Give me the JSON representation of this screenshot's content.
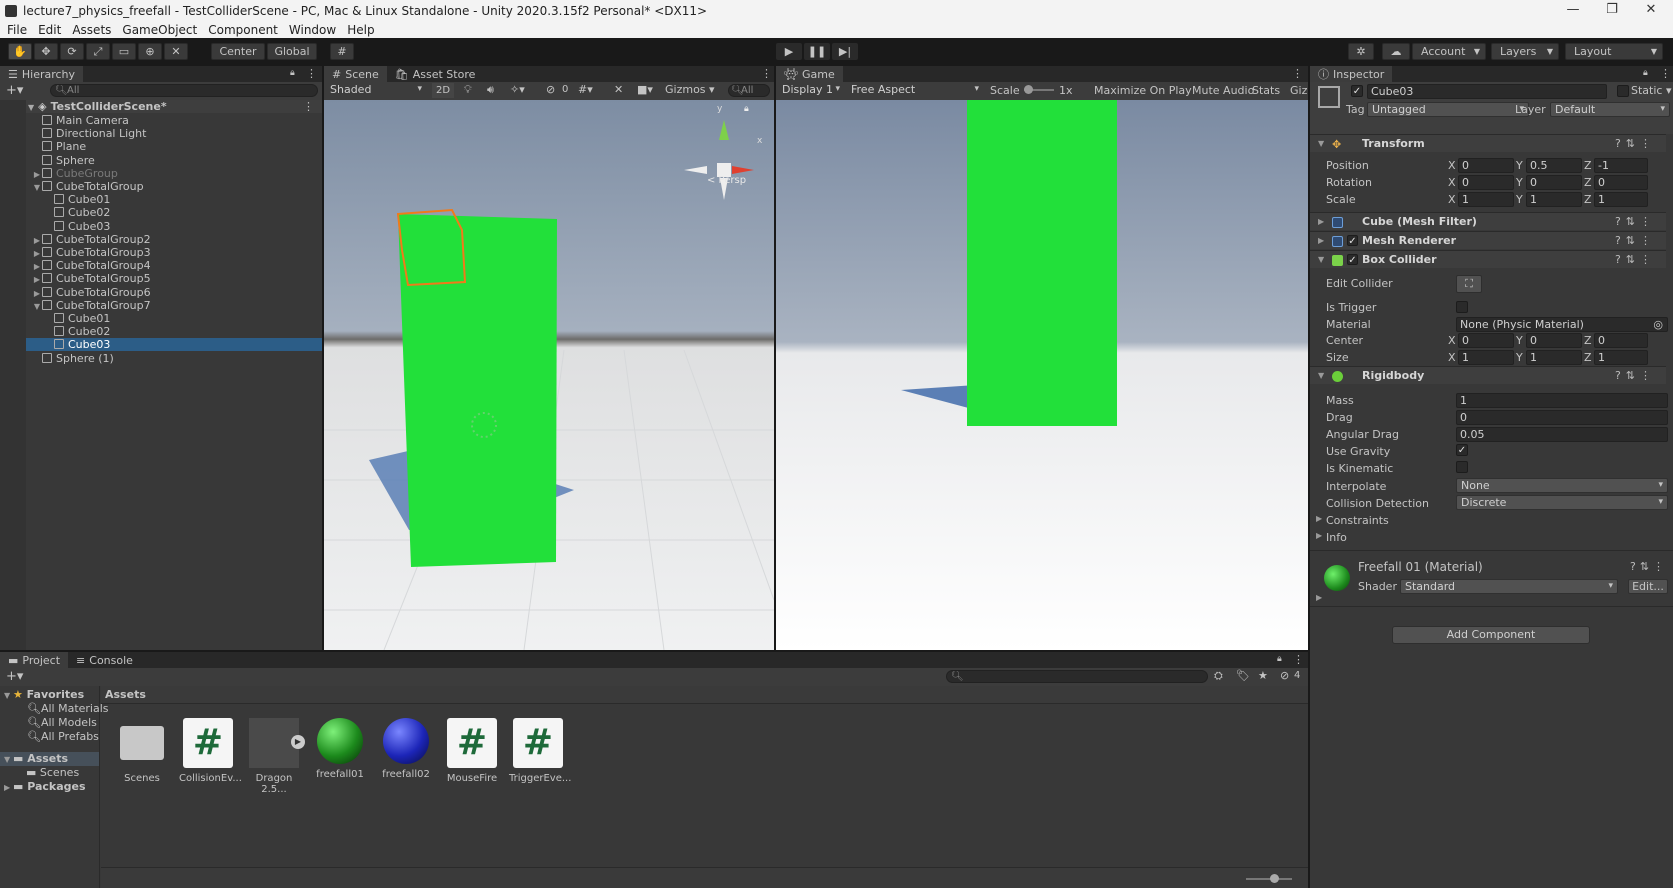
{
  "window": {
    "title": "lecture7_physics_freefall - TestColliderScene - PC, Mac & Linux Standalone - Unity 2020.3.15f2 Personal* <DX11>"
  },
  "menu": [
    "File",
    "Edit",
    "Assets",
    "GameObject",
    "Component",
    "Window",
    "Help"
  ],
  "toolbar": {
    "center": "Center",
    "global": "Global",
    "account": "Account",
    "layers": "Layers",
    "layout": "Layout"
  },
  "hierarchy": {
    "tab": "Hierarchy",
    "search_placeholder": "All",
    "scene": "TestColliderScene*",
    "items": [
      {
        "label": "Main Camera",
        "indent": 1,
        "arrow": ""
      },
      {
        "label": "Directional Light",
        "indent": 1,
        "arrow": ""
      },
      {
        "label": "Plane",
        "indent": 1,
        "arrow": ""
      },
      {
        "label": "Sphere",
        "indent": 1,
        "arrow": ""
      },
      {
        "label": "CubeGroup",
        "indent": 1,
        "arrow": "▶",
        "dim": true
      },
      {
        "label": "CubeTotalGroup",
        "indent": 1,
        "arrow": "▼"
      },
      {
        "label": "Cube01",
        "indent": 2,
        "arrow": ""
      },
      {
        "label": "Cube02",
        "indent": 2,
        "arrow": ""
      },
      {
        "label": "Cube03",
        "indent": 2,
        "arrow": ""
      },
      {
        "label": "CubeTotalGroup2",
        "indent": 1,
        "arrow": "▶"
      },
      {
        "label": "CubeTotalGroup3",
        "indent": 1,
        "arrow": "▶"
      },
      {
        "label": "CubeTotalGroup4",
        "indent": 1,
        "arrow": "▶"
      },
      {
        "label": "CubeTotalGroup5",
        "indent": 1,
        "arrow": "▶"
      },
      {
        "label": "CubeTotalGroup6",
        "indent": 1,
        "arrow": "▶"
      },
      {
        "label": "CubeTotalGroup7",
        "indent": 1,
        "arrow": "▼"
      },
      {
        "label": "Cube01",
        "indent": 2,
        "arrow": ""
      },
      {
        "label": "Cube02",
        "indent": 2,
        "arrow": ""
      },
      {
        "label": "Cube03",
        "indent": 2,
        "arrow": "",
        "selected": true
      },
      {
        "label": "Sphere (1)",
        "indent": 1,
        "arrow": ""
      }
    ]
  },
  "scene": {
    "tab": "Scene",
    "asset_store_tab": "Asset Store",
    "shading": "Shaded",
    "mode2d": "2D",
    "hidden_count": "0",
    "gizmos": "Gizmos",
    "search_placeholder": "All",
    "persp": "< Persp",
    "axis_x": "x",
    "axis_y": "y"
  },
  "game": {
    "tab": "Game",
    "display": "Display 1",
    "aspect": "Free Aspect",
    "scale_label": "Scale",
    "scale_value": "1x",
    "maximize": "Maximize On Play",
    "mute": "Mute Audio",
    "stats": "Stats",
    "gizmos": "Giz"
  },
  "inspector": {
    "tab": "Inspector",
    "name": "Cube03",
    "static": "Static",
    "tag_label": "Tag",
    "tag": "Untagged",
    "layer_label": "Layer",
    "layer": "Default",
    "transform": {
      "title": "Transform",
      "position": {
        "label": "Position",
        "x": "0",
        "y": "0.5",
        "z": "-1"
      },
      "rotation": {
        "label": "Rotation",
        "x": "0",
        "y": "0",
        "z": "0"
      },
      "scale": {
        "label": "Scale",
        "x": "1",
        "y": "1",
        "z": "1"
      }
    },
    "mesh_filter": "Cube (Mesh Filter)",
    "mesh_renderer": "Mesh Renderer",
    "box_collider": {
      "title": "Box Collider",
      "edit_label": "Edit Collider",
      "is_trigger": "Is Trigger",
      "material_label": "Material",
      "material": "None (Physic Material)",
      "center": {
        "label": "Center",
        "x": "0",
        "y": "0",
        "z": "0"
      },
      "size": {
        "label": "Size",
        "x": "1",
        "y": "1",
        "z": "1"
      }
    },
    "rigidbody": {
      "title": "Rigidbody",
      "mass_label": "Mass",
      "mass": "1",
      "drag_label": "Drag",
      "drag": "0",
      "angular_label": "Angular Drag",
      "angular": "0.05",
      "gravity_label": "Use Gravity",
      "kinematic_label": "Is Kinematic",
      "interpolate_label": "Interpolate",
      "interpolate": "None",
      "collision_label": "Collision Detection",
      "collision": "Discrete",
      "constraints": "Constraints",
      "info": "Info"
    },
    "material": {
      "name": "Freefall 01 (Material)",
      "shader_label": "Shader",
      "shader": "Standard",
      "edit": "Edit..."
    },
    "add_component": "Add Component",
    "axis": {
      "x": "X",
      "y": "Y",
      "z": "Z"
    }
  },
  "project": {
    "tab": "Project",
    "console_tab": "Console",
    "hidden_count": "4",
    "favorites": "Favorites",
    "fav_items": [
      "All Materials",
      "All Models",
      "All Prefabs"
    ],
    "assets_root": "Assets",
    "assets_children": [
      "Scenes"
    ],
    "packages": "Packages",
    "breadcrumb": "Assets",
    "assets": [
      {
        "label": "Scenes",
        "kind": "folder"
      },
      {
        "label": "CollisionEv...",
        "kind": "script"
      },
      {
        "label": "Dragon 2.5...",
        "kind": "model"
      },
      {
        "label": "freefall01",
        "kind": "green"
      },
      {
        "label": "freefall02",
        "kind": "blue"
      },
      {
        "label": "MouseFire",
        "kind": "script"
      },
      {
        "label": "TriggerEve...",
        "kind": "script"
      }
    ]
  },
  "colors": {
    "accent": "#2c5d87",
    "cube_green": "#22e03a",
    "panel": "#383838"
  }
}
